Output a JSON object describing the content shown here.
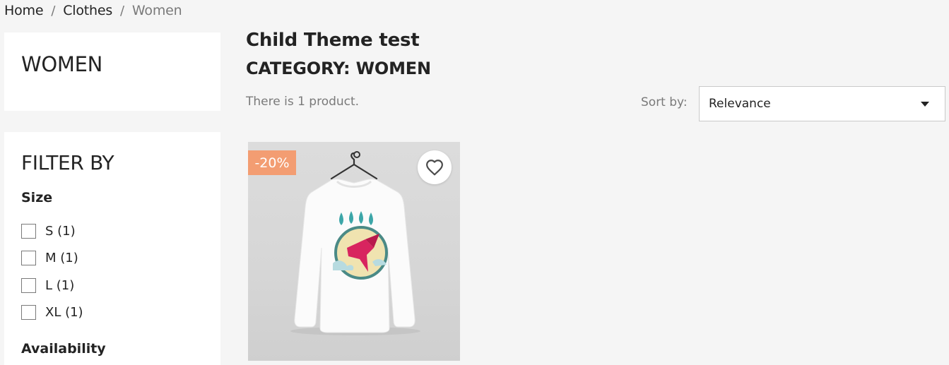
{
  "breadcrumb": {
    "home": "Home",
    "separator": "/",
    "clothes": "Clothes",
    "current": "Women"
  },
  "sidebar": {
    "category_title": "WOMEN",
    "filter_title": "FILTER BY",
    "facets": {
      "size": {
        "title": "Size",
        "options": [
          {
            "label": "S (1)",
            "checked": false
          },
          {
            "label": "M (1)",
            "checked": false
          },
          {
            "label": "L (1)",
            "checked": false
          },
          {
            "label": "XL (1)",
            "checked": false
          }
        ]
      },
      "availability": {
        "title": "Availability"
      }
    }
  },
  "main": {
    "heading": "Child Theme test",
    "subheading": "CATEGORY: WOMEN",
    "product_count": "There is 1 product.",
    "sort": {
      "label": "Sort by:",
      "selected": "Relevance"
    }
  },
  "product": {
    "discount": "-20%",
    "wishlist_icon": "heart-icon"
  },
  "colors": {
    "badge": "#f39d72",
    "background": "#f5f5f5",
    "text": "#232323",
    "muted": "#7a7a7a"
  }
}
